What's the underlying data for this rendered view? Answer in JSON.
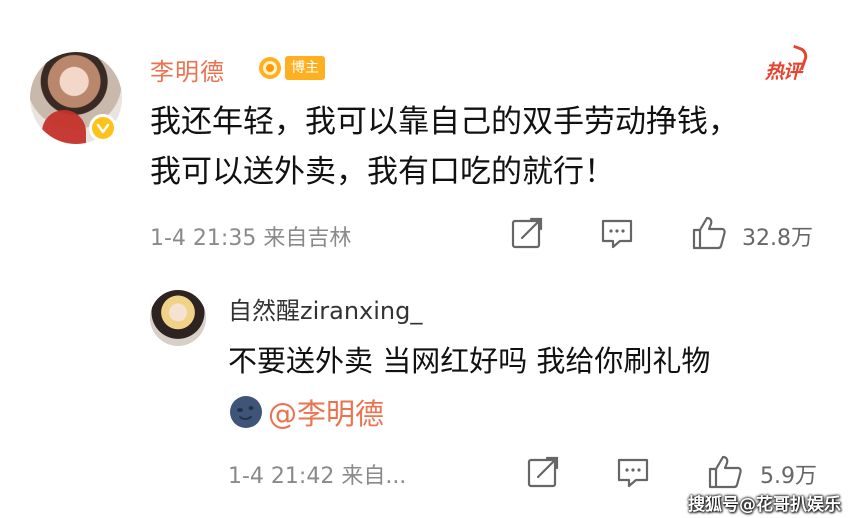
{
  "post": {
    "author": "李明德",
    "badge_label": "博主",
    "hot_label": "热评",
    "text_line1": "我还年轻，我可以靠自己的双手劳动挣钱，",
    "text_line2": "我可以送外卖，我有口吃的就行！",
    "meta": "1-4 21:35  来自吉林",
    "likes": "32.8万",
    "colors": {
      "name": "#eb7350",
      "verified": "#ffc21a"
    }
  },
  "reply": {
    "author": "自然醒ziranxing_",
    "text": "不要送外卖 当网红好吗 我给你刷礼物",
    "mention": "@李明德",
    "meta": "1-4 21:42  来自...",
    "likes": "5.9万"
  },
  "icons": {
    "share": "share-icon",
    "comment": "comment-icon",
    "like": "thumbs-up-icon",
    "verified": "verified-badge-icon",
    "emoji": "moon-face-emoji-icon"
  },
  "watermark": "搜狐号@花哥扒娱乐"
}
